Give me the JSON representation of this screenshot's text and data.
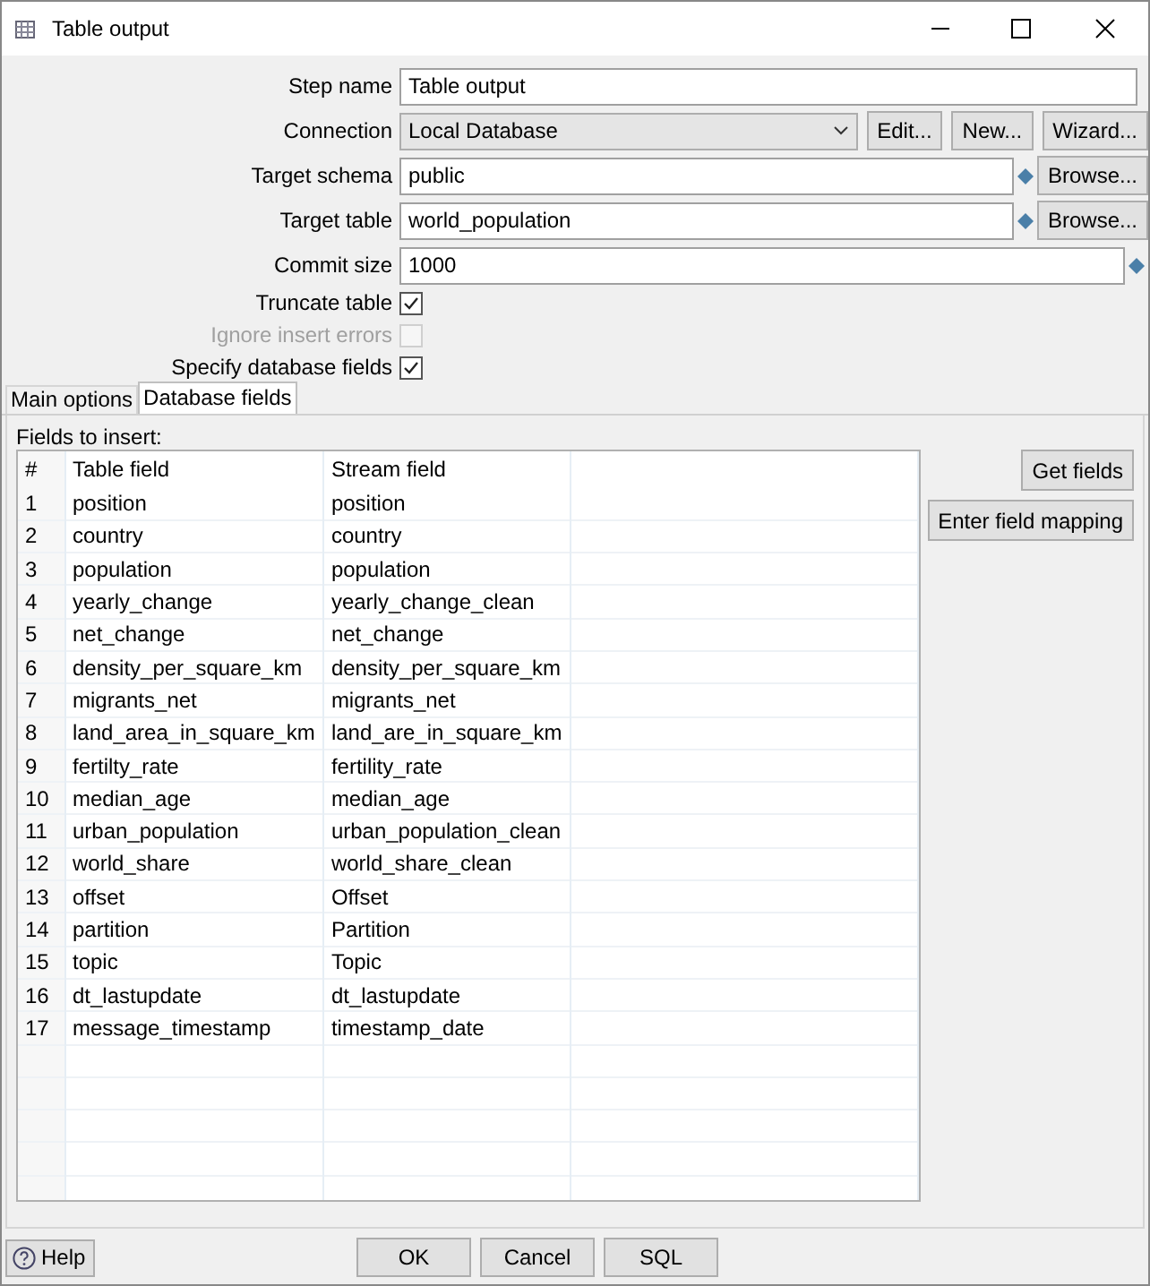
{
  "window": {
    "title": "Table output"
  },
  "form": {
    "step_name": {
      "label": "Step name",
      "value": "Table output"
    },
    "connection": {
      "label": "Connection",
      "value": "Local Database",
      "buttons": [
        "Edit...",
        "New...",
        "Wizard..."
      ]
    },
    "target_schema": {
      "label": "Target schema",
      "value": "public",
      "button": "Browse..."
    },
    "target_table": {
      "label": "Target table",
      "value": "world_population",
      "button": "Browse..."
    },
    "commit_size": {
      "label": "Commit size",
      "value": "1000"
    },
    "checkboxes": [
      {
        "label": "Truncate table",
        "checked": true,
        "disabled": false
      },
      {
        "label": "Ignore insert errors",
        "checked": false,
        "disabled": true
      },
      {
        "label": "Specify database fields",
        "checked": true,
        "disabled": false
      }
    ]
  },
  "tabs": [
    {
      "label": "Main options",
      "selected": false
    },
    {
      "label": "Database fields",
      "selected": true
    }
  ],
  "fields_label": "Fields to insert:",
  "table": {
    "columns": [
      "#",
      "Table field",
      "Stream field"
    ],
    "rows": [
      [
        "1",
        "position",
        "position"
      ],
      [
        "2",
        "country",
        "country"
      ],
      [
        "3",
        "population",
        "population"
      ],
      [
        "4",
        "yearly_change",
        "yearly_change_clean"
      ],
      [
        "5",
        "net_change",
        "net_change"
      ],
      [
        "6",
        "density_per_square_km",
        "density_per_square_km"
      ],
      [
        "7",
        "migrants_net",
        "migrants_net"
      ],
      [
        "8",
        "land_area_in_square_km",
        "land_are_in_square_km"
      ],
      [
        "9",
        "fertilty_rate",
        "fertility_rate"
      ],
      [
        "10",
        "median_age",
        "median_age"
      ],
      [
        "11",
        "urban_population",
        "urban_population_clean"
      ],
      [
        "12",
        "world_share",
        "world_share_clean"
      ],
      [
        "13",
        "offset",
        "Offset"
      ],
      [
        "14",
        "partition",
        "Partition"
      ],
      [
        "15",
        "topic",
        "Topic"
      ],
      [
        "16",
        "dt_lastupdate",
        "dt_lastupdate"
      ],
      [
        "17",
        "message_timestamp",
        "timestamp_date"
      ]
    ]
  },
  "side_buttons": [
    "Get fields",
    "Enter field mapping"
  ],
  "footer": {
    "help": "Help",
    "buttons": [
      "OK",
      "Cancel",
      "SQL"
    ]
  }
}
